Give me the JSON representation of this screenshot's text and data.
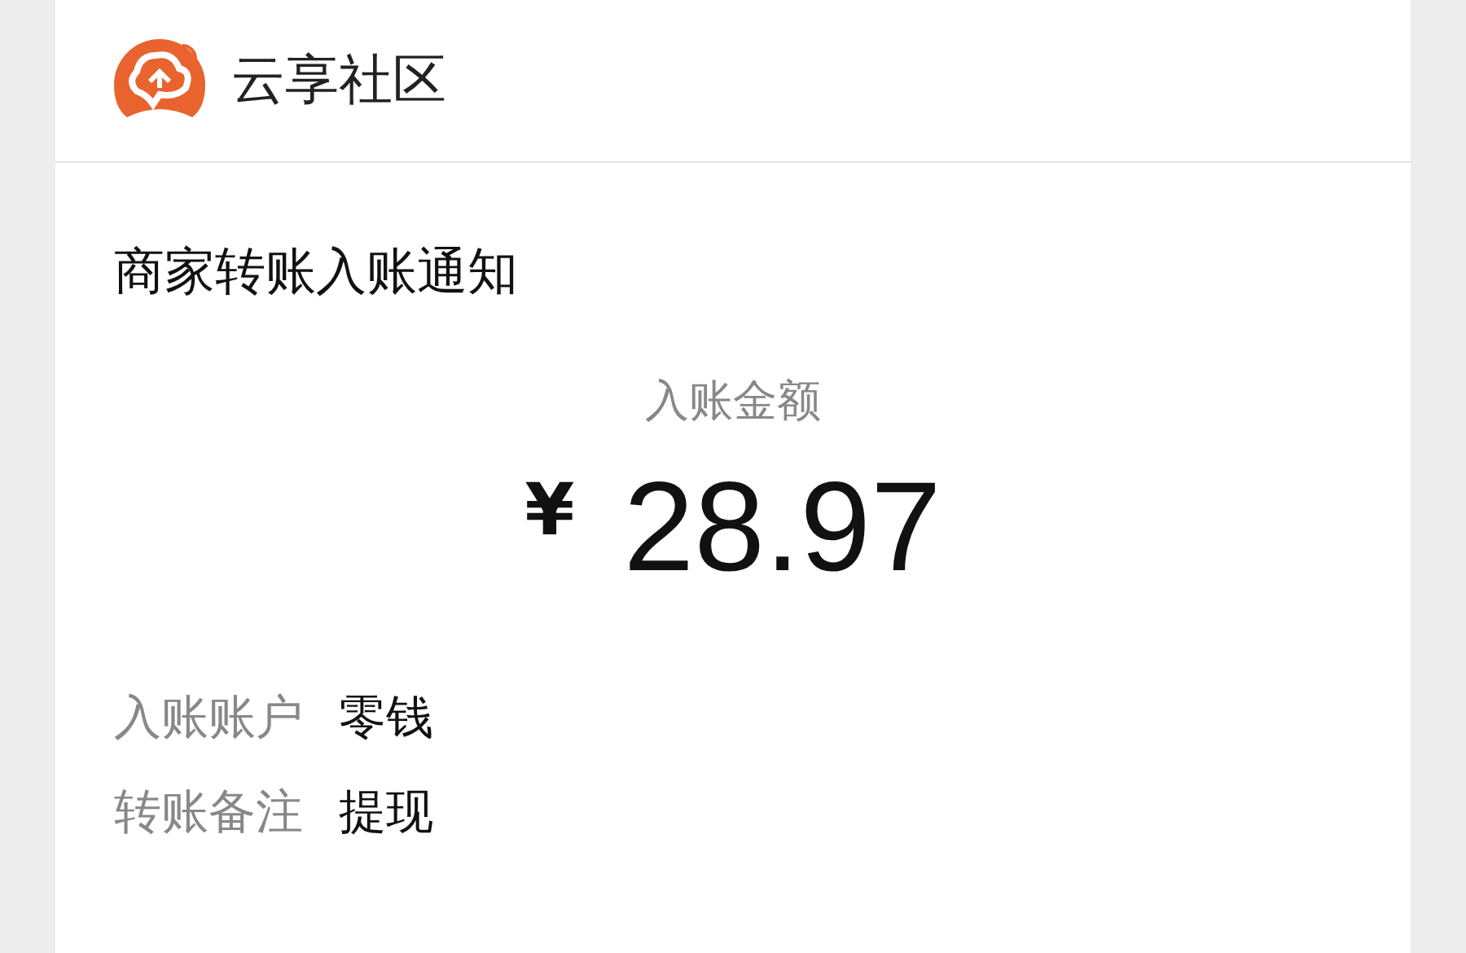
{
  "header": {
    "title": "云享社区"
  },
  "notice": {
    "title": "商家转账入账通知",
    "amount_label": "入账金额",
    "currency": "¥",
    "amount": "28.97",
    "details": [
      {
        "label": "入账账户",
        "value": "零钱"
      },
      {
        "label": "转账备注",
        "value": "提现"
      }
    ]
  }
}
